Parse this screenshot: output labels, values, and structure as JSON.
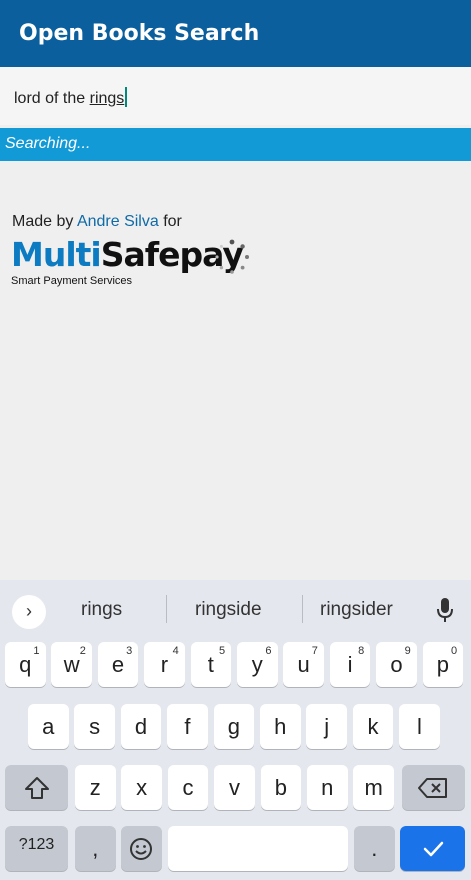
{
  "appbar": {
    "title": "Open Books Search"
  },
  "search": {
    "value_prefix": "lord of the ",
    "value_last": "rings"
  },
  "status": {
    "text": "Searching..."
  },
  "credit": {
    "prefix": "Made by ",
    "author": "Andre Silva",
    "suffix": " for"
  },
  "logo": {
    "multi": "Multi",
    "safe": "Safepay",
    "tagline": "Smart Payment Services"
  },
  "keyboard": {
    "suggestions": [
      "rings",
      "ringside",
      "ringsider"
    ],
    "row1": [
      {
        "k": "q",
        "n": "1"
      },
      {
        "k": "w",
        "n": "2"
      },
      {
        "k": "e",
        "n": "3"
      },
      {
        "k": "r",
        "n": "4"
      },
      {
        "k": "t",
        "n": "5"
      },
      {
        "k": "y",
        "n": "6"
      },
      {
        "k": "u",
        "n": "7"
      },
      {
        "k": "i",
        "n": "8"
      },
      {
        "k": "o",
        "n": "9"
      },
      {
        "k": "p",
        "n": "0"
      }
    ],
    "row2": [
      "a",
      "s",
      "d",
      "f",
      "g",
      "h",
      "j",
      "k",
      "l"
    ],
    "row3": [
      "z",
      "x",
      "c",
      "v",
      "b",
      "n",
      "m"
    ],
    "sym_label": "?123",
    "comma": ",",
    "period": "."
  }
}
